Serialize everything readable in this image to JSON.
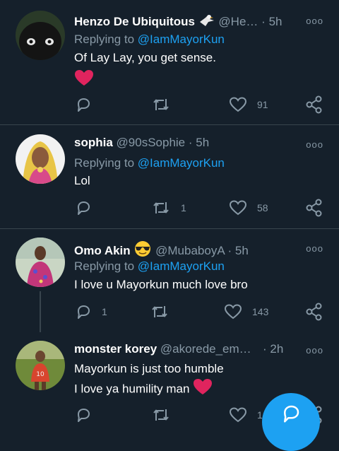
{
  "tweets": [
    {
      "name": "Henzo De Ubiquitous",
      "handle": "@He…",
      "dot": "·",
      "time": "5h",
      "replying_prefix": "Replying to ",
      "replying_to": "@IamMayorKun",
      "text": "Of Lay Lay, you get sense.",
      "replies": "",
      "retweets": "",
      "likes": "91"
    },
    {
      "name": "sophia",
      "handle": "@90sSophie",
      "dot": "·",
      "time": "5h",
      "replying_prefix": "Replying to ",
      "replying_to": "@IamMayorKun",
      "text": "Lol",
      "replies": "",
      "retweets": "1",
      "likes": "58"
    },
    {
      "name": "Omo Akin",
      "handle": "@MubaboyA",
      "dot": "·",
      "time": "5h",
      "replying_prefix": "Replying to ",
      "replying_to": "@IamMayorKun",
      "text": "I love u Mayorkun much love bro",
      "replies": "1",
      "retweets": "",
      "likes": "143"
    },
    {
      "name": "monster korey",
      "handle": "@akorede_em…",
      "dot": "·",
      "time": "2h",
      "text_line1": "Mayorkun is just too humble",
      "text_line2": "I love ya humility man",
      "replies": "",
      "retweets": "",
      "likes": "1"
    }
  ],
  "more_label": "ooo",
  "colors": {
    "background": "#15202b",
    "divider": "#38444d",
    "muted": "#8899a6",
    "accent": "#1da1f2",
    "heart": "#e0245e"
  },
  "icons": [
    "reply-icon",
    "retweet-icon",
    "like-icon",
    "share-icon",
    "heart-emoji",
    "eagle-emoji",
    "sunglasses-emoji",
    "compose-reply-icon"
  ]
}
